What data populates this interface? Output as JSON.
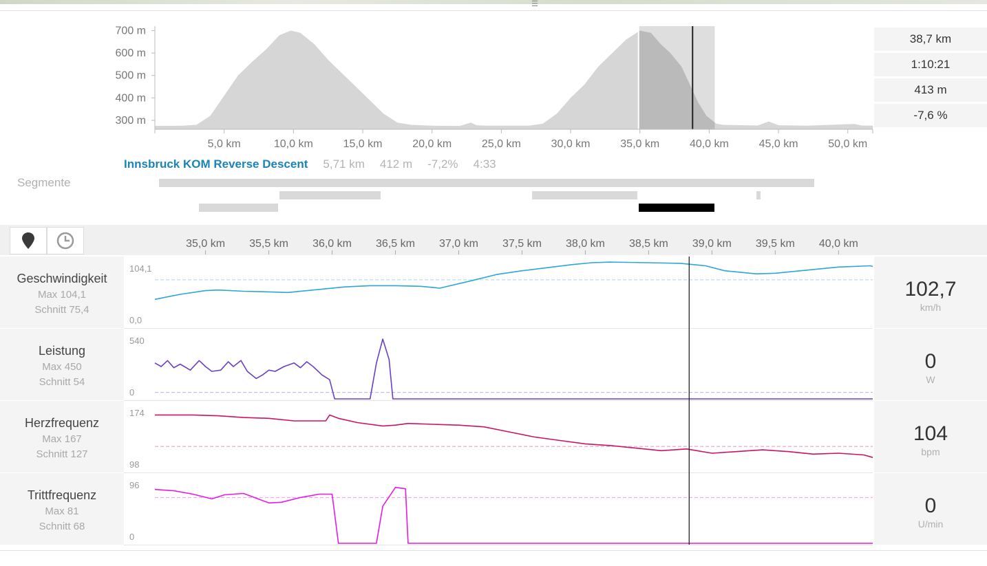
{
  "profile": {
    "y_ticks": [
      "700 m",
      "600 m",
      "500 m",
      "400 m",
      "300 m"
    ],
    "x_ticks": [
      "5,0 km",
      "10,0 km",
      "15,0 km",
      "20,0 km",
      "25,0 km",
      "30,0 km",
      "35,0 km",
      "40,0 km",
      "45,0 km",
      "50,0 km"
    ],
    "ylim": [
      260,
      720
    ],
    "xlim": [
      0,
      51.8
    ],
    "elevation": [
      [
        0,
        275
      ],
      [
        2,
        276
      ],
      [
        3,
        280
      ],
      [
        4,
        320
      ],
      [
        5,
        410
      ],
      [
        6,
        500
      ],
      [
        7,
        560
      ],
      [
        8,
        615
      ],
      [
        9,
        680
      ],
      [
        9.8,
        700
      ],
      [
        10.5,
        690
      ],
      [
        11.5,
        640
      ],
      [
        12.5,
        570
      ],
      [
        13.5,
        510
      ],
      [
        14.5,
        450
      ],
      [
        15.5,
        390
      ],
      [
        16.5,
        330
      ],
      [
        17.5,
        290
      ],
      [
        18.5,
        280
      ],
      [
        20,
        276
      ],
      [
        22,
        275
      ],
      [
        22.8,
        290
      ],
      [
        23.2,
        278
      ],
      [
        24,
        276
      ],
      [
        27,
        276
      ],
      [
        28,
        285
      ],
      [
        29,
        330
      ],
      [
        30,
        400
      ],
      [
        31,
        460
      ],
      [
        32,
        540
      ],
      [
        33,
        600
      ],
      [
        34,
        660
      ],
      [
        35,
        700
      ],
      [
        35.8,
        690
      ],
      [
        36.5,
        640
      ],
      [
        37.2,
        600
      ],
      [
        38,
        540
      ],
      [
        38.6,
        460
      ],
      [
        39.2,
        380
      ],
      [
        39.8,
        320
      ],
      [
        40.5,
        285
      ],
      [
        41,
        280
      ],
      [
        43.5,
        277
      ],
      [
        44.3,
        295
      ],
      [
        45,
        278
      ],
      [
        47,
        276
      ],
      [
        50.5,
        284
      ],
      [
        51,
        277
      ],
      [
        51.8,
        276
      ]
    ],
    "selection_km": [
      34.9,
      40.4
    ],
    "cursor_km": 38.8
  },
  "stats": [
    "38,7 km",
    "1:10:21",
    "413 m",
    "-7,6 %"
  ],
  "segment": {
    "name": "Innsbruck KOM Reverse Descent",
    "distance": "5,71 km",
    "elevation": "412 m",
    "grade": "-7,2%",
    "time": "4:33"
  },
  "segments_label": "Segmente",
  "segment_bars": [
    {
      "from": 0.3,
      "to": 47.6,
      "lane": 0,
      "active": false
    },
    {
      "from": 9.0,
      "to": 16.3,
      "lane": 1,
      "active": false
    },
    {
      "from": 27.2,
      "to": 34.8,
      "lane": 1,
      "active": false
    },
    {
      "from": 43.4,
      "to": 43.7,
      "lane": 1,
      "active": false
    },
    {
      "from": 3.2,
      "to": 8.9,
      "lane": 2,
      "active": false
    },
    {
      "from": 34.9,
      "to": 40.4,
      "lane": 2,
      "active": true
    }
  ],
  "toolbar": {
    "buttons": [
      "location-pin-icon",
      "clock-icon"
    ]
  },
  "zoom": {
    "x_ticks": [
      "35,0 km",
      "35,5 km",
      "36,0 km",
      "36,5 km",
      "37,0 km",
      "37,5 km",
      "38,0 km",
      "38,5 km",
      "39,0 km",
      "39,5 km",
      "40,0 km"
    ],
    "xlim": [
      34.6,
      40.27
    ],
    "cursor_km": 38.82
  },
  "sensors": [
    {
      "name": "Geschwindigkeit",
      "max": "Max 104,1",
      "avg": "Schnitt 75,4",
      "ymax_label": "104,1",
      "ymin_label": "0,0",
      "value": "102,7",
      "unit": "km/h",
      "color": "#2aa6d8",
      "ylim": [
        0,
        104.1
      ],
      "avg_value": 75.4,
      "points": [
        [
          34.6,
          44
        ],
        [
          34.8,
          52
        ],
        [
          35.0,
          58
        ],
        [
          35.1,
          59
        ],
        [
          35.3,
          57
        ],
        [
          35.5,
          56
        ],
        [
          35.65,
          55
        ],
        [
          35.9,
          60
        ],
        [
          36.1,
          64
        ],
        [
          36.3,
          66
        ],
        [
          36.5,
          66
        ],
        [
          36.7,
          65
        ],
        [
          36.85,
          62
        ],
        [
          37.1,
          74
        ],
        [
          37.3,
          84
        ],
        [
          37.5,
          90
        ],
        [
          37.7,
          95
        ],
        [
          37.9,
          100
        ],
        [
          38.05,
          103
        ],
        [
          38.2,
          104
        ],
        [
          38.5,
          103
        ],
        [
          38.75,
          102
        ],
        [
          38.95,
          98
        ],
        [
          39.1,
          90
        ],
        [
          39.35,
          85
        ],
        [
          39.5,
          86
        ],
        [
          39.75,
          91
        ],
        [
          40.0,
          96
        ],
        [
          40.25,
          98
        ],
        [
          40.4,
          95
        ],
        [
          40.55,
          86
        ],
        [
          40.75,
          80
        ],
        [
          40.9,
          88
        ],
        [
          41.1,
          95
        ],
        [
          41.35,
          98
        ],
        [
          41.55,
          101
        ],
        [
          41.65,
          104
        ],
        [
          41.85,
          100
        ],
        [
          42.05,
          101
        ],
        [
          42.3,
          98
        ],
        [
          42.6,
          100
        ],
        [
          42.75,
          94
        ],
        [
          42.95,
          87
        ],
        [
          43.2,
          90
        ],
        [
          43.5,
          94
        ],
        [
          43.8,
          96
        ],
        [
          40.27,
          97
        ]
      ]
    },
    {
      "name": "Leistung",
      "max": "Max 450",
      "avg": "Schnitt 54",
      "ymax_label": "540",
      "ymin_label": "0",
      "value": "0",
      "unit": "W",
      "color": "#6a3fc8",
      "ylim": [
        0,
        540
      ],
      "avg_value": 54,
      "points": [
        [
          34.6,
          300
        ],
        [
          34.65,
          270
        ],
        [
          34.7,
          320
        ],
        [
          34.75,
          260
        ],
        [
          34.8,
          290
        ],
        [
          34.88,
          240
        ],
        [
          34.95,
          320
        ],
        [
          35.0,
          270
        ],
        [
          35.05,
          230
        ],
        [
          35.12,
          240
        ],
        [
          35.18,
          310
        ],
        [
          35.22,
          270
        ],
        [
          35.28,
          320
        ],
        [
          35.33,
          230
        ],
        [
          35.4,
          170
        ],
        [
          35.45,
          200
        ],
        [
          35.5,
          240
        ],
        [
          35.55,
          230
        ],
        [
          35.62,
          270
        ],
        [
          35.7,
          300
        ],
        [
          35.75,
          260
        ],
        [
          35.8,
          310
        ],
        [
          35.85,
          270
        ],
        [
          35.92,
          200
        ],
        [
          35.98,
          160
        ],
        [
          36.02,
          0
        ],
        [
          36.3,
          0
        ],
        [
          36.35,
          300
        ],
        [
          36.4,
          500
        ],
        [
          36.45,
          330
        ],
        [
          36.48,
          0
        ],
        [
          40.27,
          0
        ]
      ]
    },
    {
      "name": "Herzfrequenz",
      "max": "Max 167",
      "avg": "Schnitt 127",
      "ymax_label": "174",
      "ymin_label": "98",
      "value": "104",
      "unit": "bpm",
      "color": "#cc1166",
      "ylim": [
        98,
        174
      ],
      "avg_value": 127,
      "points": [
        [
          34.6,
          164
        ],
        [
          34.9,
          164
        ],
        [
          35.1,
          163
        ],
        [
          35.3,
          161
        ],
        [
          35.5,
          160
        ],
        [
          35.7,
          157
        ],
        [
          35.95,
          157
        ],
        [
          35.98,
          164
        ],
        [
          36.05,
          160
        ],
        [
          36.2,
          155
        ],
        [
          36.4,
          151
        ],
        [
          36.5,
          152
        ],
        [
          36.6,
          154
        ],
        [
          36.8,
          153
        ],
        [
          37.0,
          152
        ],
        [
          37.2,
          150
        ],
        [
          37.4,
          144
        ],
        [
          37.6,
          138
        ],
        [
          37.8,
          134
        ],
        [
          38.0,
          130
        ],
        [
          38.2,
          128
        ],
        [
          38.4,
          125
        ],
        [
          38.6,
          122
        ],
        [
          38.8,
          124
        ],
        [
          39.0,
          119
        ],
        [
          39.2,
          121
        ],
        [
          39.4,
          123
        ],
        [
          39.6,
          121
        ],
        [
          39.8,
          118
        ],
        [
          40.0,
          119
        ],
        [
          40.2,
          117
        ],
        [
          40.4,
          116
        ],
        [
          40.55,
          117
        ],
        [
          40.6,
          113
        ],
        [
          40.75,
          118
        ],
        [
          41.0,
          119
        ],
        [
          41.3,
          115
        ],
        [
          41.6,
          114
        ],
        [
          41.9,
          111
        ],
        [
          42.2,
          109
        ],
        [
          42.5,
          110
        ],
        [
          43.0,
          110
        ],
        [
          43.5,
          111
        ],
        [
          43.8,
          112
        ],
        [
          40.27,
          114
        ]
      ]
    },
    {
      "name": "Trittfrequenz",
      "max": "Max 81",
      "avg": "Schnitt 68",
      "ymax_label": "96",
      "ymin_label": "0",
      "value": "0",
      "unit": "U/min",
      "color": "#e619e6",
      "ylim": [
        0,
        96
      ],
      "avg_value": 68,
      "points": [
        [
          34.6,
          80
        ],
        [
          34.75,
          78
        ],
        [
          34.9,
          73
        ],
        [
          35.05,
          66
        ],
        [
          35.15,
          72
        ],
        [
          35.3,
          74
        ],
        [
          35.4,
          67
        ],
        [
          35.5,
          60
        ],
        [
          35.6,
          61
        ],
        [
          35.75,
          68
        ],
        [
          35.9,
          73
        ],
        [
          36.0,
          73
        ],
        [
          36.05,
          0
        ],
        [
          36.3,
          0
        ],
        [
          36.35,
          0
        ],
        [
          36.4,
          55
        ],
        [
          36.5,
          83
        ],
        [
          36.58,
          81
        ],
        [
          36.6,
          0
        ],
        [
          40.27,
          0
        ]
      ]
    }
  ]
}
